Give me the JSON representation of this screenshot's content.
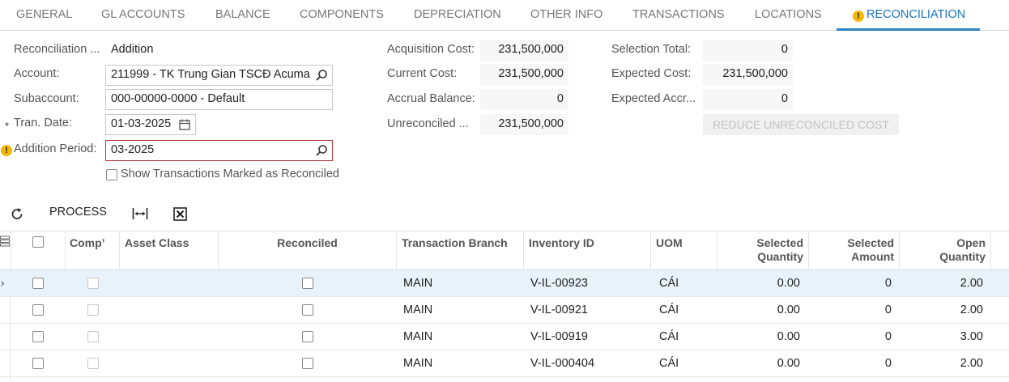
{
  "tabs": [
    {
      "label": "GENERAL"
    },
    {
      "label": "GL ACCOUNTS"
    },
    {
      "label": "BALANCE"
    },
    {
      "label": "COMPONENTS"
    },
    {
      "label": "DEPRECIATION"
    },
    {
      "label": "OTHER INFO"
    },
    {
      "label": "TRANSACTIONS"
    },
    {
      "label": "LOCATIONS"
    },
    {
      "label": "RECONCILIATION",
      "active": true,
      "warning": true
    }
  ],
  "form": {
    "reconciliation_type_label": "Reconciliation ...",
    "reconciliation_type_value": "Addition",
    "account_label": "Account:",
    "account_value": "211999 - TK Trung Gian TSCĐ Acuma",
    "subaccount_label": "Subaccount:",
    "subaccount_value": "000-00000-0000 - Default",
    "tran_date_label": "Tran. Date:",
    "tran_date_value": "01-03-2025",
    "addition_period_label": "Addition Period:",
    "addition_period_value": "03-2025",
    "show_reconciled_label": "Show Transactions Marked as Reconciled",
    "acquisition_cost_label": "Acquisition Cost:",
    "acquisition_cost_value": "231,500,000",
    "current_cost_label": "Current Cost:",
    "current_cost_value": "231,500,000",
    "accrual_balance_label": "Accrual Balance:",
    "accrual_balance_value": "0",
    "unreconciled_label": "Unreconciled ...",
    "unreconciled_value": "231,500,000",
    "selection_total_label": "Selection Total:",
    "selection_total_value": "0",
    "expected_cost_label": "Expected Cost:",
    "expected_cost_value": "231,500,000",
    "expected_accr_label": "Expected Accr...",
    "expected_accr_value": "0",
    "reduce_button": "REDUCE UNRECONCILED COST"
  },
  "toolbar": {
    "process_label": "PROCESS",
    "icons": [
      "refresh-icon",
      "fit-columns-icon",
      "export-excel-icon"
    ]
  },
  "grid": {
    "headers": {
      "comp": "Comp’",
      "asset_class": "Asset Class",
      "reconciled": "Reconciled",
      "transaction_branch": "Transaction Branch",
      "inventory_id": "Inventory ID",
      "uom": "UOM",
      "selected_quantity_1": "Selected",
      "selected_quantity_2": "Quantity",
      "selected_amount_1": "Selected",
      "selected_amount_2": "Amount",
      "open_quantity_1": "Open",
      "open_quantity_2": "Quantity"
    },
    "rows": [
      {
        "branch": "MAIN",
        "inventory_id": "V-IL-00923",
        "uom": "CÁI",
        "selected_quantity": "0.00",
        "selected_amount": "0",
        "open_quantity": "2.00"
      },
      {
        "branch": "MAIN",
        "inventory_id": "V-IL-00921",
        "uom": "CÁI",
        "selected_quantity": "0.00",
        "selected_amount": "0",
        "open_quantity": "2.00"
      },
      {
        "branch": "MAIN",
        "inventory_id": "V-IL-00919",
        "uom": "CÁI",
        "selected_quantity": "0.00",
        "selected_amount": "0",
        "open_quantity": "3.00"
      },
      {
        "branch": "MAIN",
        "inventory_id": "V-IL-000404",
        "uom": "CÁI",
        "selected_quantity": "0.00",
        "selected_amount": "0",
        "open_quantity": "2.00"
      }
    ]
  },
  "colors": {
    "accent": "#2d82c3",
    "warning": "#f5b800",
    "error_border": "#b33a3a",
    "selected_row": "#e8f2fb"
  }
}
